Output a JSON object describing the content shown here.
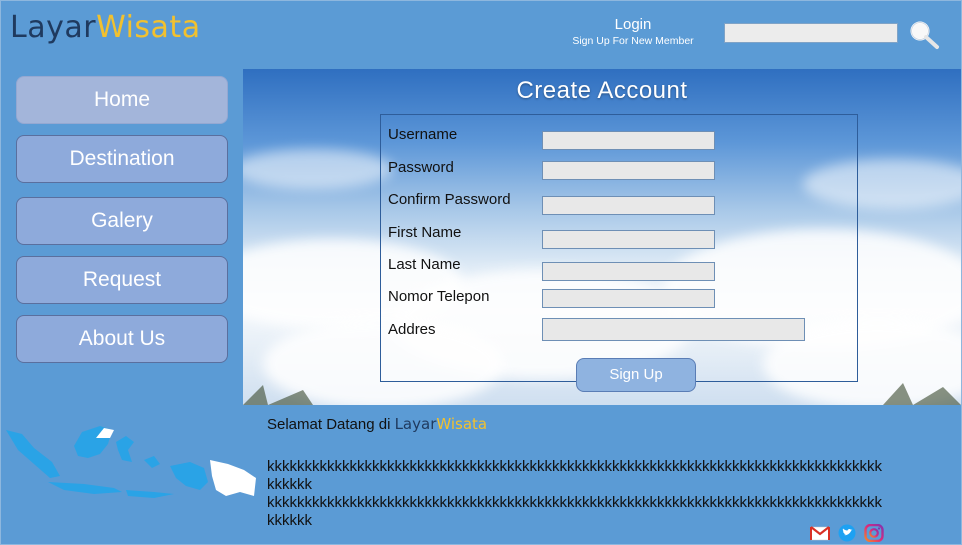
{
  "brand": {
    "part1": "Layar",
    "part2": "Wisata"
  },
  "header": {
    "login_label": "Login",
    "signup_link": "Sign Up For New Member",
    "search_value": ""
  },
  "nav": [
    {
      "label": "Home",
      "active": true
    },
    {
      "label": "Destination"
    },
    {
      "label": "Galery"
    },
    {
      "label": "Request"
    },
    {
      "label": "About Us"
    }
  ],
  "form": {
    "title": "Create Account",
    "fields": [
      {
        "label": "Username",
        "value": ""
      },
      {
        "label": "Password",
        "value": ""
      },
      {
        "label": "Confirm Password",
        "value": ""
      },
      {
        "label": "First Name",
        "value": ""
      },
      {
        "label": "Last Name",
        "value": ""
      },
      {
        "label": "Nomor Telepon",
        "value": ""
      },
      {
        "label": "Addres",
        "value": ""
      }
    ],
    "submit_label": "Sign Up"
  },
  "footer": {
    "welcome_prefix": "Selamat Datang di ",
    "body_line1": "kkkkkkkkkkkkkkkkkkkkkkkkkkkkkkkkkkkkkkkkkkkkkkkkkkkkkkkkkkkkkkkkkkkkkkkkkkkkkkkkkkkkkkkk",
    "body_line2": "kkkkkkkkkkkkkkkkkkkkkkkkkkkkkkkkkkkkkkkkkkkkkkkkkkkkkkkkkkkkkkkkkkkkkkkkkkkkkkkkkkkkkkkk",
    "social": [
      "gmail-icon",
      "twitter-icon",
      "instagram-icon"
    ]
  },
  "colors": {
    "background": "#5b9bd5",
    "brand_dark": "#1f3a5f",
    "brand_yellow": "#f2c12e",
    "nav_button": "#8eaadb"
  }
}
